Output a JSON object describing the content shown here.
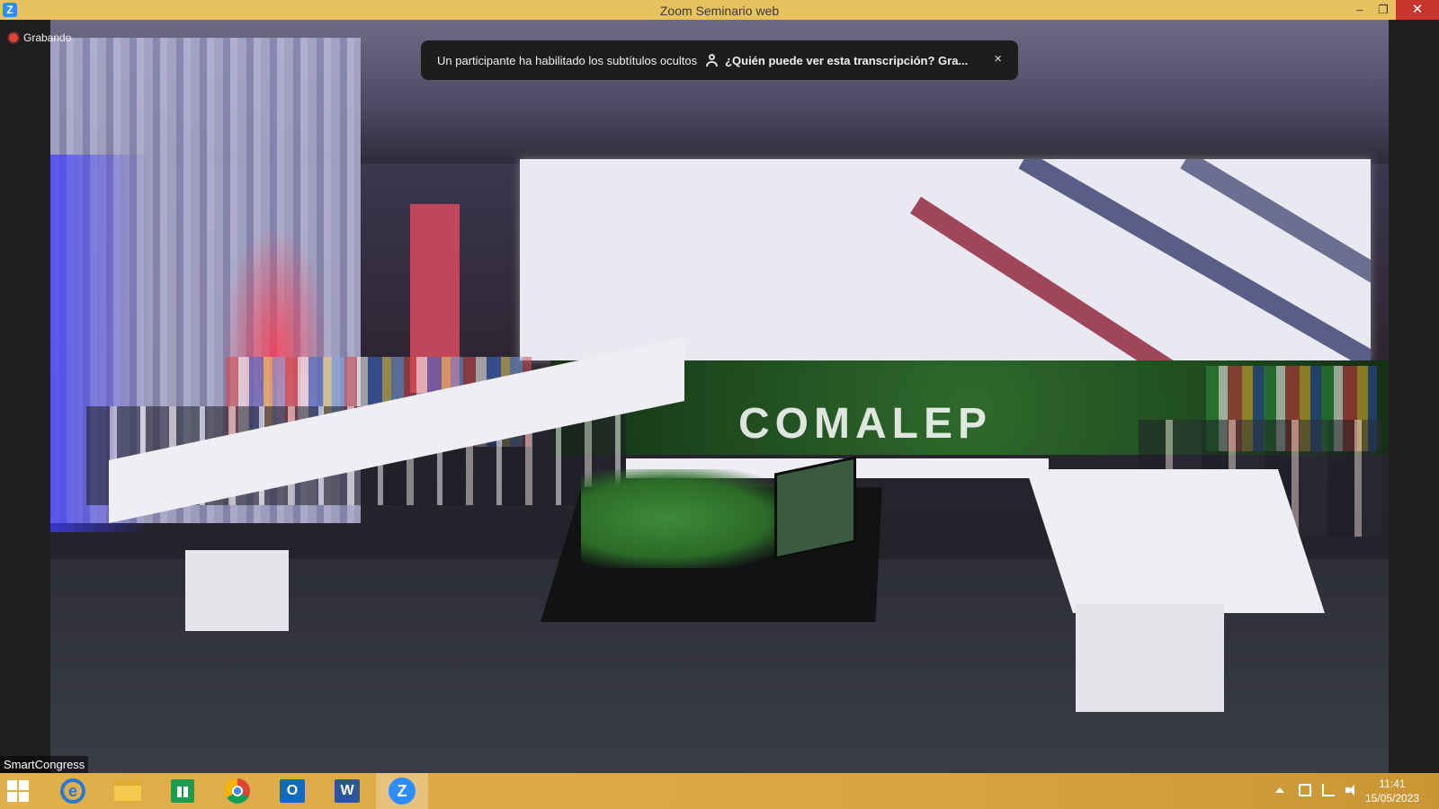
{
  "window": {
    "title": "Zoom Seminario web",
    "app_icon_letter": "Z",
    "minimize_glyph": "–",
    "maximize_glyph": "❐",
    "close_glyph": "✕"
  },
  "recording": {
    "label": "Grabando",
    "dot_color": "#e14438"
  },
  "caption_notice": {
    "message": "Un participante ha habilitado los subtítulos ocultos",
    "link_text": "¿Quién puede ver esta transcripción? Gra...",
    "close_glyph": "×",
    "icon": "person-icon"
  },
  "video": {
    "speaker_name": "SmartCongress",
    "logo_text": "COMALEP"
  },
  "taskbar": {
    "apps": [
      {
        "name": "internet-explorer",
        "glyph": "e"
      },
      {
        "name": "file-explorer",
        "glyph": ""
      },
      {
        "name": "windows-store",
        "glyph": ""
      },
      {
        "name": "chrome",
        "glyph": ""
      },
      {
        "name": "outlook",
        "glyph": "O"
      },
      {
        "name": "word",
        "glyph": "W"
      },
      {
        "name": "zoom",
        "glyph": "Z"
      }
    ],
    "clock_time": "11:41",
    "clock_date": "15/05/2023",
    "accent": "#e0b04c"
  }
}
